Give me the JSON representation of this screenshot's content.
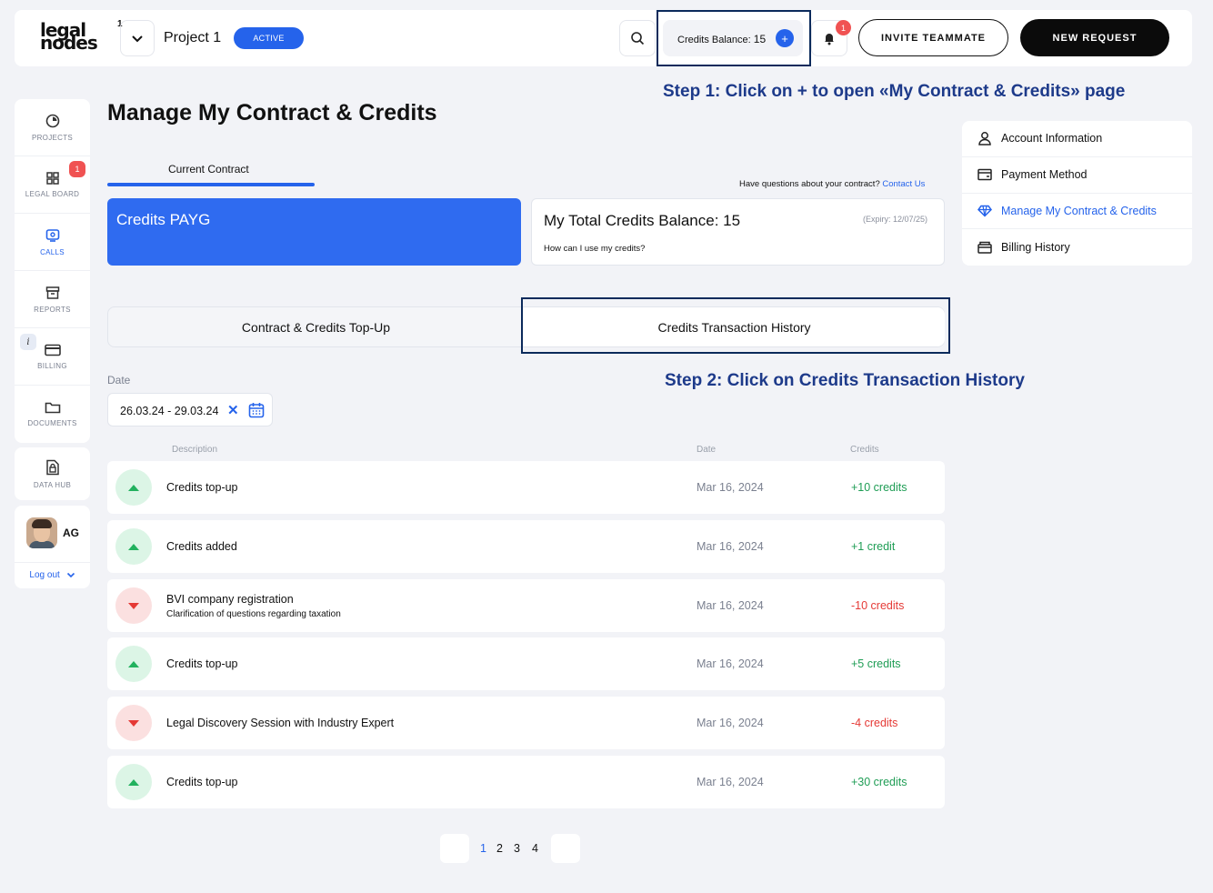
{
  "header": {
    "logo_line1": "legal",
    "logo_line2": "nodes",
    "project_count": "1",
    "project_name": "Project 1",
    "project_status": "ACTIVE",
    "credits_label": "Credits Balance:",
    "credits_value": "15",
    "add_credits_symbol": "+",
    "notifications_count": "1",
    "invite_label": "INVITE TEAMMATE",
    "new_request_label": "NEW REQUEST"
  },
  "sidebar": {
    "items": [
      {
        "label": "PROJECTS",
        "icon": "projects-icon"
      },
      {
        "label": "LEGAL BOARD",
        "icon": "grid-icon",
        "badge": "1"
      },
      {
        "label": "CALLS",
        "icon": "calls-icon"
      },
      {
        "label": "REPORTS",
        "icon": "archive-icon"
      },
      {
        "label": "BILLING",
        "icon": "card-icon",
        "info": "i"
      },
      {
        "label": "DOCUMENTS",
        "icon": "folder-icon"
      }
    ],
    "data_hub": "DATA HUB",
    "user_initials": "AG",
    "logout": "Log out"
  },
  "main": {
    "title": "Manage My Contract & Credits",
    "current_tab": "Current Contract",
    "questions_text": "Have questions about your contract?",
    "contact_link": "Contact Us",
    "plan_name": "Credits PAYG",
    "balance_title": "My Total Credits Balance: 15",
    "expiry": "(Expiry: 12/07/25)",
    "how_use": "How can I use my credits?",
    "tab_topup": "Contract & Credits Top-Up",
    "tab_history": "Credits Transaction History",
    "date_label": "Date",
    "date_value": "26.03.24 - 29.03.24",
    "clear_symbol": "✕",
    "columns": {
      "description": "Description",
      "date": "Date",
      "credits": "Credits"
    },
    "transactions": [
      {
        "direction": "up",
        "description": "Credits top-up",
        "subtitle": "",
        "date": "Mar 16, 2024",
        "credits": "+10 credits"
      },
      {
        "direction": "up",
        "description": "Credits added",
        "subtitle": "",
        "date": "Mar 16, 2024",
        "credits": "+1 credit"
      },
      {
        "direction": "down",
        "description": "BVI company registration",
        "subtitle": "Clarification of questions regarding taxation",
        "date": "Mar 16, 2024",
        "credits": "-10 credits"
      },
      {
        "direction": "up",
        "description": "Credits top-up",
        "subtitle": "",
        "date": "Mar 16, 2024",
        "credits": "+5 credits"
      },
      {
        "direction": "down",
        "description": "Legal Discovery Session with Industry Expert",
        "subtitle": "",
        "date": "Mar 16, 2024",
        "credits": "-4 credits"
      },
      {
        "direction": "up",
        "description": "Credits top-up",
        "subtitle": "",
        "date": "Mar 16, 2024",
        "credits": "+30 credits"
      }
    ],
    "pagination": {
      "pages": [
        "1",
        "2",
        "3",
        "4"
      ],
      "current": "1"
    }
  },
  "annotations": {
    "step1": "Step 1: Click on + to open «My Contract & Credits» page",
    "step2": "Step 2: Click on Credits Transaction History"
  },
  "account_menu": {
    "items": [
      {
        "label": "Account Information",
        "icon": "user-icon"
      },
      {
        "label": "Payment Method",
        "icon": "wallet-icon"
      },
      {
        "label": "Manage My Contract & Credits",
        "icon": "diamond-icon",
        "active": true
      },
      {
        "label": "Billing History",
        "icon": "history-icon"
      }
    ]
  },
  "colors": {
    "accent": "#2563eb",
    "highlight_border": "#0b2a5b",
    "positive": "#1f9d55",
    "negative": "#e53935",
    "annotation": "#1d3a8a"
  }
}
